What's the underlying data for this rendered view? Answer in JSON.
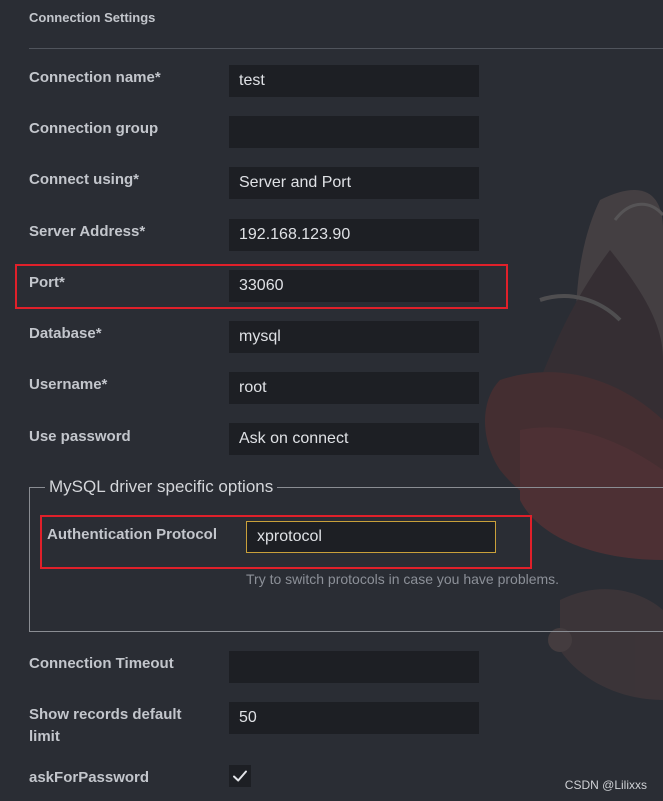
{
  "section_title": "Connection Settings",
  "fields": {
    "connection_name": {
      "label": "Connection name*",
      "value": "test"
    },
    "connection_group": {
      "label": "Connection group",
      "value": ""
    },
    "connect_using": {
      "label": "Connect using*",
      "value": "Server and Port"
    },
    "server_address": {
      "label": "Server Address*",
      "value": "192.168.123.90"
    },
    "port": {
      "label": "Port*",
      "value": "33060"
    },
    "database": {
      "label": "Database*",
      "value": "mysql"
    },
    "username": {
      "label": "Username*",
      "value": "root"
    },
    "use_password": {
      "label": "Use password",
      "value": "Ask on connect"
    }
  },
  "driver_options": {
    "legend": "MySQL driver specific options",
    "auth_protocol": {
      "label": "Authentication Protocol",
      "value": "xprotocol"
    },
    "hint": "Try to switch protocols in case you have problems."
  },
  "connection_timeout": {
    "label": "Connection Timeout",
    "value": ""
  },
  "show_records_limit": {
    "label": "Show records default limit",
    "value": "50"
  },
  "ask_for_password": {
    "label": "askForPassword",
    "checked": true
  },
  "watermark": "CSDN @Lilixxs",
  "colors": {
    "highlight": "#e0202a",
    "focus_border": "#c9a03a",
    "background": "#2a2d34"
  }
}
